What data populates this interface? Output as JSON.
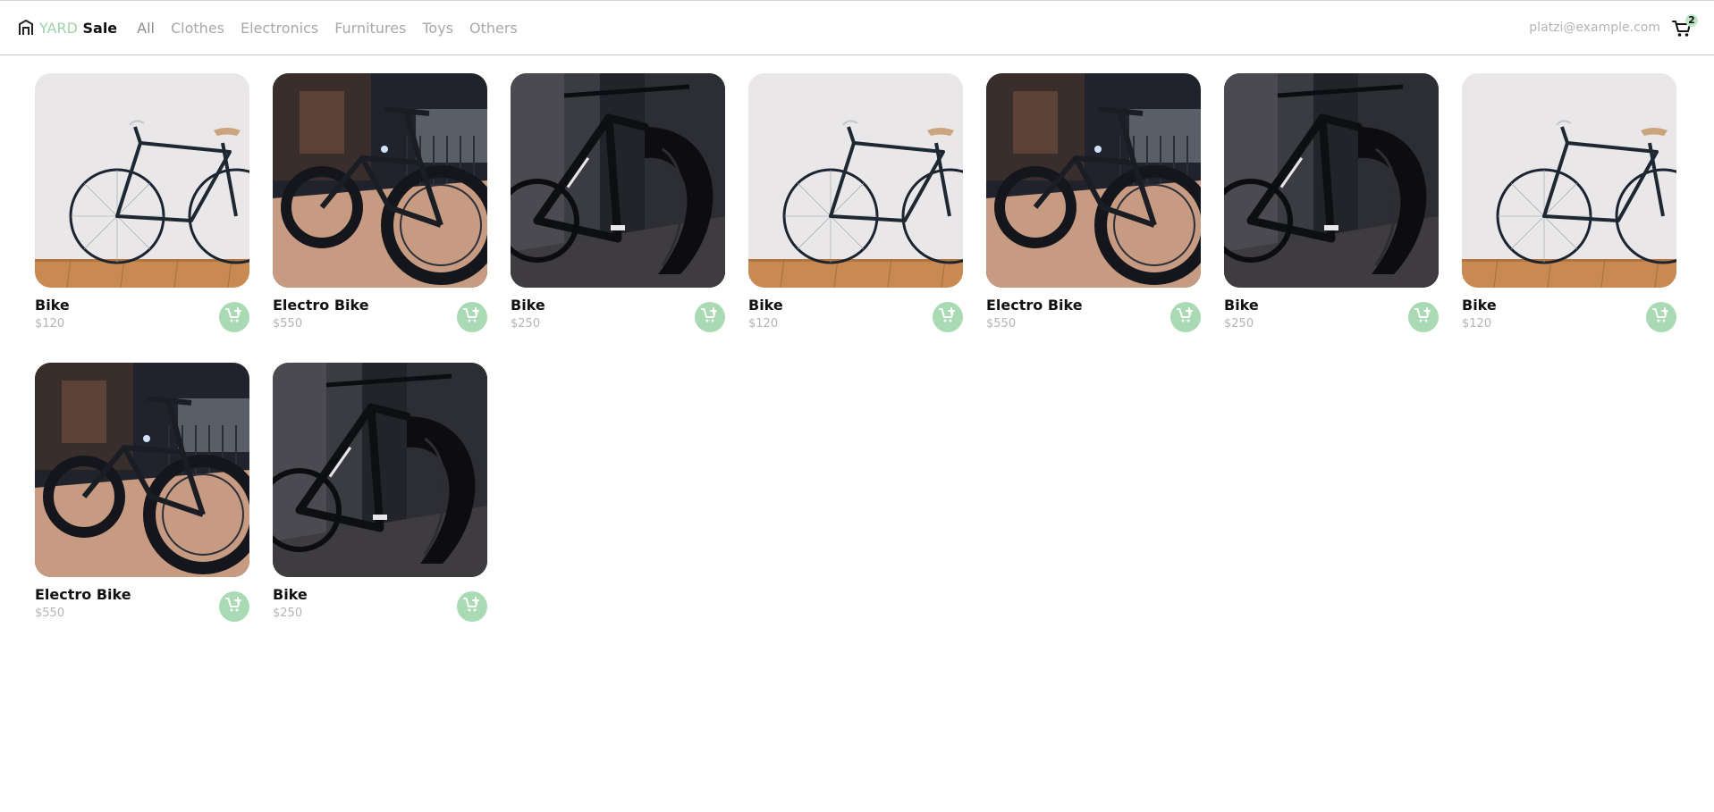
{
  "brand": {
    "accent": "YARD",
    "main": "Sale"
  },
  "nav": {
    "items": [
      {
        "label": "All",
        "active": true
      },
      {
        "label": "Clothes"
      },
      {
        "label": "Electronics"
      },
      {
        "label": "Furnitures"
      },
      {
        "label": "Toys"
      },
      {
        "label": "Others"
      }
    ]
  },
  "user": {
    "email": "platzi@example.com"
  },
  "cart": {
    "count": "2"
  },
  "colors": {
    "accent": "#a9dab4",
    "brand_accent": "#9cd3a8"
  },
  "products": [
    {
      "title": "Bike",
      "price": "$120",
      "image": "white-wall-city-bike"
    },
    {
      "title": "Electro Bike",
      "price": "$550",
      "image": "fat-tire-electric-bike"
    },
    {
      "title": "Bike",
      "price": "$250",
      "image": "black-carbon-bike"
    },
    {
      "title": "Bike",
      "price": "$120",
      "image": "white-wall-city-bike"
    },
    {
      "title": "Electro Bike",
      "price": "$550",
      "image": "fat-tire-electric-bike"
    },
    {
      "title": "Bike",
      "price": "$250",
      "image": "black-carbon-bike"
    },
    {
      "title": "Bike",
      "price": "$120",
      "image": "white-wall-city-bike"
    },
    {
      "title": "Electro Bike",
      "price": "$550",
      "image": "fat-tire-electric-bike"
    },
    {
      "title": "Bike",
      "price": "$250",
      "image": "black-carbon-bike"
    }
  ],
  "icons": {
    "logo": "shop-storefront-icon",
    "cart": "shopping-cart-icon",
    "add": "add-to-cart-icon"
  }
}
